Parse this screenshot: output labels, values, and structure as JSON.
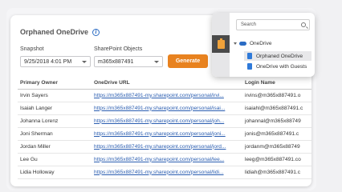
{
  "report": {
    "title": "Orphaned OneDrive",
    "snapshot_label": "Snapshot",
    "snapshot_value": "9/25/2018 4:01 PM",
    "objects_label": "SharePoint Objects",
    "objects_value": "m365x887491",
    "generate_label": "Generate"
  },
  "table": {
    "headers": [
      "Primary Owner",
      "OneDrive URL",
      "Login Name"
    ],
    "rows": [
      [
        "Irvin Sayers",
        "https://m365x887491-my.sharepoint.com/personal/irvi...",
        "irvins@m365x887491.o"
      ],
      [
        "Isaiah Langer",
        "https://m365x887491-my.sharepoint.com/personal/isai...",
        "isaiahl@m365x887491.c"
      ],
      [
        "Johanna Lorenz",
        "https://m365x887491-my.sharepoint.com/personal/joh...",
        "johannal@m365x88749"
      ],
      [
        "Joni Sherman",
        "https://m365x887491-my.sharepoint.com/personal/joni...",
        "jonis@m365x887491.c"
      ],
      [
        "Jordan Miller",
        "https://m365x887491-my.sharepoint.com/personal/jord...",
        "jordanm@m365x88749"
      ],
      [
        "Lee Gu",
        "https://m365x887491-my.sharepoint.com/personal/lee...",
        "leeg@m365x887491.co"
      ],
      [
        "Lidia Holloway",
        "https://m365x887491-my.sharepoint.com/personal/lidi...",
        "lidiah@m365x887491.c"
      ]
    ]
  },
  "popup": {
    "search_placeholder": "Search",
    "tree": {
      "root": "OneDrive",
      "children": [
        "Orphaned OneDrive",
        "OneDrive with Guests"
      ]
    }
  },
  "colors": {
    "accent": "#e8821f",
    "link": "#2a5db0",
    "icon_blue": "#2b6cc4"
  }
}
